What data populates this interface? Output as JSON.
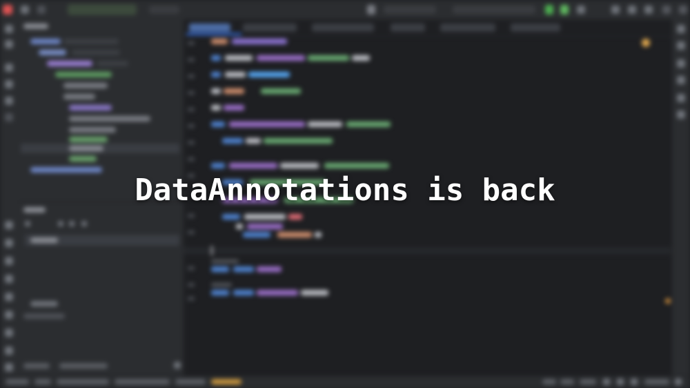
{
  "overlay": {
    "title": "DataAnnotations is back"
  },
  "colors": {
    "background": "#1e1f22",
    "panel": "#2b2d30",
    "keyword": "#cf8e6d",
    "type": "#6aab73",
    "identifier": "#56a8f5",
    "purple": "#c77dff",
    "text": "#bcbec4",
    "warning": "#e0a84e",
    "title_text": "#ffffff"
  },
  "icons": {
    "app_logo": "app-logo-icon",
    "run": "run-icon",
    "debug": "debug-icon",
    "search": "search-icon",
    "settings": "gear-icon",
    "warning": "warning-icon"
  }
}
